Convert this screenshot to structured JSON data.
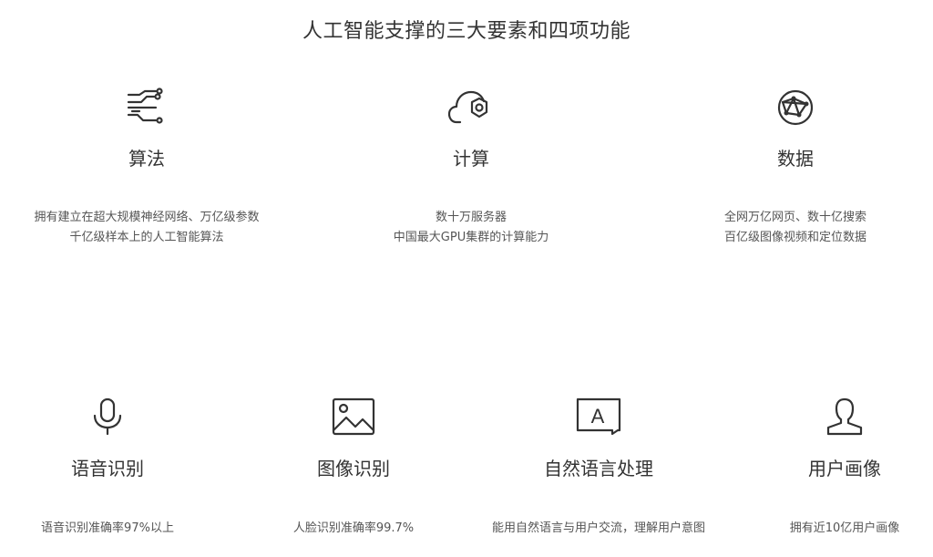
{
  "section": {
    "title": "人工智能支撑的三大要素和四项功能"
  },
  "elements": [
    {
      "name": "算法",
      "icon": "algorithm-icon",
      "desc": [
        "拥有建立在超大规模神经网络、万亿级参数",
        "千亿级样本上的人工智能算法"
      ]
    },
    {
      "name": "计算",
      "icon": "cloud-compute-icon",
      "desc": [
        "数十万服务器",
        "中国最大GPU集群的计算能力"
      ]
    },
    {
      "name": "数据",
      "icon": "globe-network-icon",
      "desc": [
        "全网万亿网页、数十亿搜索",
        "百亿级图像视频和定位数据"
      ]
    }
  ],
  "functions": [
    {
      "name": "语音识别",
      "icon": "microphone-icon",
      "desc": "语音识别准确率97%以上"
    },
    {
      "name": "图像识别",
      "icon": "image-icon",
      "desc": "人脸识别准确率99.7%"
    },
    {
      "name": "自然语言处理",
      "icon": "text-bubble-icon",
      "desc": "能用自然语言与用户交流，理解用户意图"
    },
    {
      "name": "用户画像",
      "icon": "user-profile-icon",
      "desc": "拥有近10亿用户画像"
    }
  ]
}
